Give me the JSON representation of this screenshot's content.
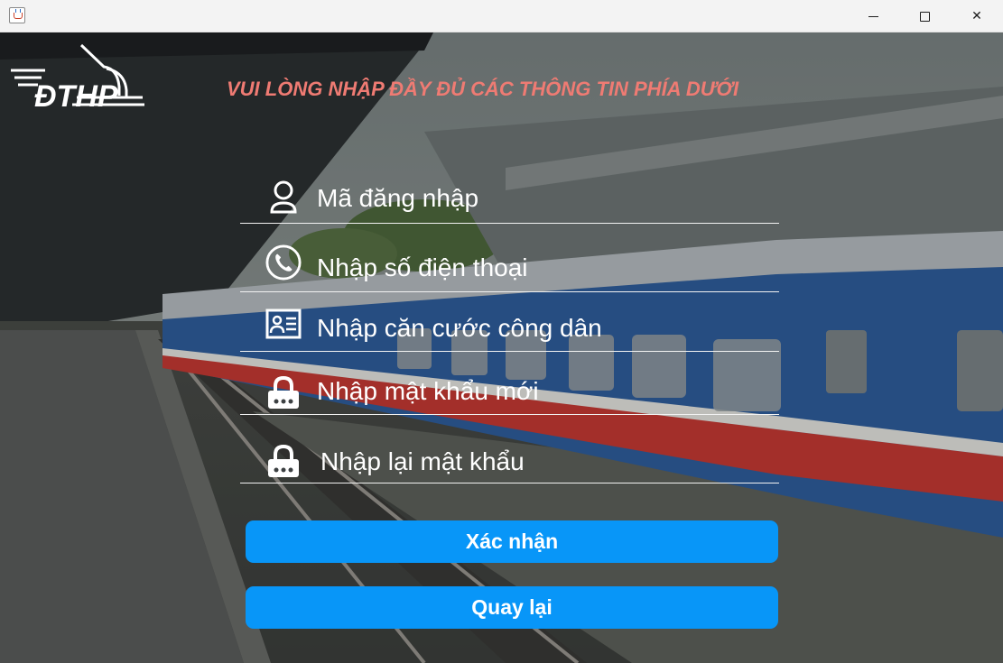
{
  "window": {
    "minimize_icon": "minimize-icon",
    "maximize_icon": "maximize-icon",
    "close_icon": "close-icon",
    "close_glyph": "✕"
  },
  "logo": {
    "text": "ĐTHP"
  },
  "form": {
    "title": "VUI LÒNG NHẬP ĐẦY ĐỦ CÁC THÔNG TIN PHÍA DƯỚI",
    "fields": [
      {
        "icon": "user-icon",
        "placeholder": "Mã đăng nhập"
      },
      {
        "icon": "phone-icon",
        "placeholder": "Nhập số điện thoại"
      },
      {
        "icon": "id-card-icon",
        "placeholder": "Nhập căn cước công dân"
      },
      {
        "icon": "lock-icon",
        "placeholder": "Nhập mật khẩu mới"
      },
      {
        "icon": "lock-icon",
        "placeholder": "Nhập lại mật khẩu"
      }
    ],
    "confirm_label": "Xác nhận",
    "back_label": "Quay lại"
  },
  "colors": {
    "title": "#ef7b73",
    "button": "#0896f8",
    "text": "#ffffff"
  }
}
